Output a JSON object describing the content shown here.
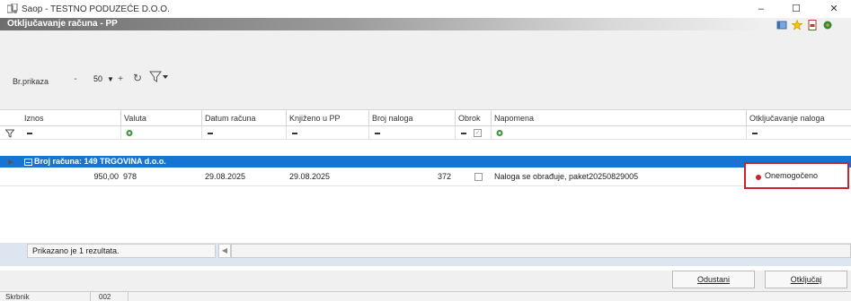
{
  "window": {
    "title": "Saop  - TESTNO PODUZEĆE D.O.O.",
    "minimize": "–",
    "maximize": "☐",
    "close": "✕"
  },
  "banner": {
    "title": "Otključavanje računa - PP"
  },
  "toolbar": {
    "br_prikaza_label": "Br.prikaza",
    "stepper_value": "50",
    "minus": "-",
    "plus": "+",
    "caret": "▼"
  },
  "grid": {
    "columns": [
      "Iznos",
      "Valuta",
      "Datum računa",
      "Knjiženo u PP",
      "Broj naloga",
      "Obrok",
      "Napomena",
      "Otključavanje naloga"
    ],
    "group_label": "Broj računa: 149 TRGOVINA d.o.o.",
    "row": {
      "iznos": "950,00",
      "valuta": "978",
      "datum_racuna": "29.08.2025",
      "knjizeno_u_pp": "29.08.2025",
      "broj_naloga": "372",
      "napomena": "Naloga se obrađuje, paket20250829005",
      "otkljucavanje": "Onemogočeno"
    }
  },
  "footer": {
    "result_count": "Prikazano je 1 rezultata.",
    "cancel_label": "Odustani",
    "unlock_label": "Otključaj"
  },
  "statusbar": {
    "user": "Skrbnik",
    "code": "002"
  },
  "colors": {
    "group_row": "#1874d2",
    "status_red": "#d0202a",
    "selection_bar": "#dde5f0"
  }
}
